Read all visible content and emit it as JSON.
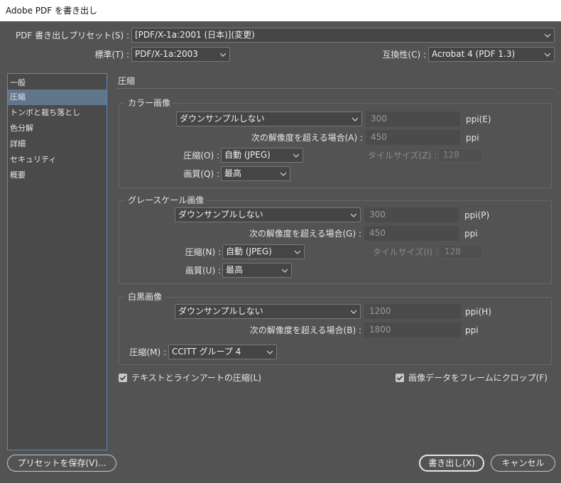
{
  "window": {
    "title": "Adobe PDF を書き出し"
  },
  "header": {
    "preset_label": "PDF 書き出しプリセット(S) :",
    "preset_value": "[PDF/X-1a:2001 (日本)](変更)",
    "standard_label": "標準(T) :",
    "standard_value": "PDF/X-1a:2003",
    "compat_label": "互換性(C) :",
    "compat_value": "Acrobat 4 (PDF 1.3)"
  },
  "sidebar": {
    "items": [
      {
        "label": "一般"
      },
      {
        "label": "圧縮"
      },
      {
        "label": "トンボと裁ち落とし"
      },
      {
        "label": "色分解"
      },
      {
        "label": "詳細"
      },
      {
        "label": "セキュリティ"
      },
      {
        "label": "概要"
      }
    ],
    "active_index": 1
  },
  "panel": {
    "title": "圧縮"
  },
  "color": {
    "group_title": "カラー画像",
    "downsample_value": "ダウンサンプルしない",
    "resolution_value": "300",
    "resolution_unit": "ppi(E)",
    "threshold_label": "次の解像度を超える場合(A) :",
    "threshold_value": "450",
    "threshold_unit": "ppi",
    "compression_label": "圧縮(O) :",
    "compression_value": "自動 (JPEG)",
    "tile_label": "タイルサイズ(Z) :",
    "tile_value": "128",
    "quality_label": "画質(Q) :",
    "quality_value": "最高"
  },
  "gray": {
    "group_title": "グレースケール画像",
    "downsample_value": "ダウンサンプルしない",
    "resolution_value": "300",
    "resolution_unit": "ppi(P)",
    "threshold_label": "次の解像度を超える場合(G) :",
    "threshold_value": "450",
    "threshold_unit": "ppi",
    "compression_label": "圧縮(N) :",
    "compression_value": "自動 (JPEG)",
    "tile_label": "タイルサイズ(I) :",
    "tile_value": "128",
    "quality_label": "画質(U) :",
    "quality_value": "最高"
  },
  "mono": {
    "group_title": "白黒画像",
    "downsample_value": "ダウンサンプルしない",
    "resolution_value": "1200",
    "resolution_unit": "ppi(H)",
    "threshold_label": "次の解像度を超える場合(B) :",
    "threshold_value": "1800",
    "threshold_unit": "ppi",
    "compression_label": "圧縮(M) :",
    "compression_value": "CCITT グループ 4"
  },
  "options": {
    "text_art_label": "テキストとラインアートの圧縮(L)",
    "text_art_checked": true,
    "crop_label": "画像データをフレームにクロップ(F)",
    "crop_checked": true
  },
  "footer": {
    "save_preset_label": "プリセットを保存(V)...",
    "export_label": "書き出し(X)",
    "cancel_label": "キャンセル"
  }
}
